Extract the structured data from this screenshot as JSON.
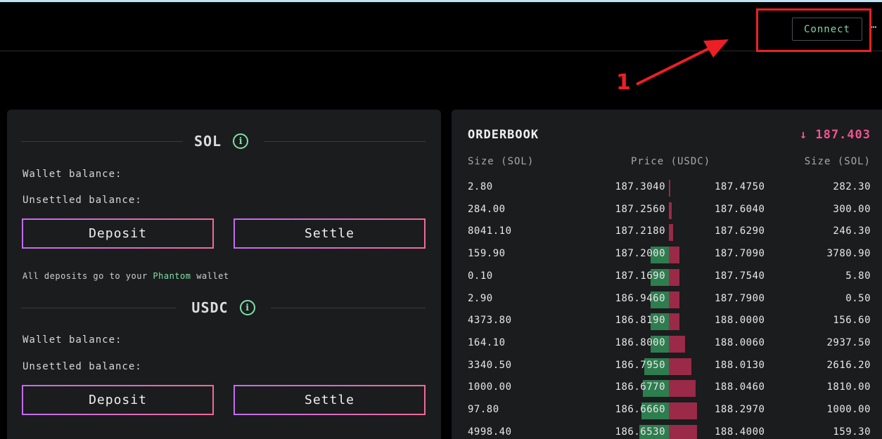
{
  "header": {
    "connect_label": "Connect",
    "more_icon": "ellipsis-icon"
  },
  "annotation": {
    "number": "1",
    "color": "#ec1f26"
  },
  "balances": {
    "sol": {
      "token": "SOL",
      "wallet_balance_label": "Wallet balance:",
      "unsettled_balance_label": "Unsettled balance:",
      "deposit_label": "Deposit",
      "settle_label": "Settle"
    },
    "note": {
      "prefix": "All deposits go to your",
      "wallet": "Phantom",
      "suffix": "wallet"
    },
    "usdc": {
      "token": "USDC",
      "wallet_balance_label": "Wallet balance:",
      "unsettled_balance_label": "Unsettled balance:",
      "deposit_label": "Deposit",
      "settle_label": "Settle"
    }
  },
  "orderbook": {
    "title": "ORDERBOOK",
    "last_price": "187.403",
    "last_direction_icon": "arrow-down-icon",
    "headers": {
      "bid_size": "Size (SOL)",
      "price": "Price (USDC)",
      "ask_size": "Size (SOL)"
    },
    "colors": {
      "bid": "#2e7d4f",
      "ask": "#9a2a47",
      "down": "#f0548e"
    },
    "rows": [
      {
        "bid_size": "2.80",
        "bid_price": "187.3040",
        "ask_price": "187.4750",
        "ask_size": "282.30",
        "bid_depth": 0.0,
        "ask_depth": 0.05
      },
      {
        "bid_size": "284.00",
        "bid_price": "187.2560",
        "ask_price": "187.6040",
        "ask_size": "300.00",
        "bid_depth": 0.0,
        "ask_depth": 0.1
      },
      {
        "bid_size": "8041.10",
        "bid_price": "187.2180",
        "ask_price": "187.6290",
        "ask_size": "246.30",
        "bid_depth": 0.0,
        "ask_depth": 0.15
      },
      {
        "bid_size": "159.90",
        "bid_price": "187.2000",
        "ask_price": "187.7090",
        "ask_size": "3780.90",
        "bid_depth": 0.5,
        "ask_depth": 0.38
      },
      {
        "bid_size": "0.10",
        "bid_price": "187.1690",
        "ask_price": "187.7540",
        "ask_size": "5.80",
        "bid_depth": 0.5,
        "ask_depth": 0.38
      },
      {
        "bid_size": "2.90",
        "bid_price": "186.9460",
        "ask_price": "187.7900",
        "ask_size": "0.50",
        "bid_depth": 0.5,
        "ask_depth": 0.38
      },
      {
        "bid_size": "4373.80",
        "bid_price": "186.8190",
        "ask_price": "188.0000",
        "ask_size": "156.60",
        "bid_depth": 0.5,
        "ask_depth": 0.38
      },
      {
        "bid_size": "164.10",
        "bid_price": "186.8000",
        "ask_price": "188.0060",
        "ask_size": "2937.50",
        "bid_depth": 0.5,
        "ask_depth": 0.58
      },
      {
        "bid_size": "3340.50",
        "bid_price": "186.7950",
        "ask_price": "188.0130",
        "ask_size": "2616.20",
        "bid_depth": 0.68,
        "ask_depth": 0.8
      },
      {
        "bid_size": "1000.00",
        "bid_price": "186.6770",
        "ask_price": "188.0460",
        "ask_size": "1810.00",
        "bid_depth": 0.72,
        "ask_depth": 0.95
      },
      {
        "bid_size": "97.80",
        "bid_price": "186.6660",
        "ask_price": "188.2970",
        "ask_size": "1000.00",
        "bid_depth": 0.75,
        "ask_depth": 1.0
      },
      {
        "bid_size": "4998.40",
        "bid_price": "186.6530",
        "ask_price": "188.4000",
        "ask_size": "159.30",
        "bid_depth": 0.8,
        "ask_depth": 1.0
      }
    ]
  }
}
